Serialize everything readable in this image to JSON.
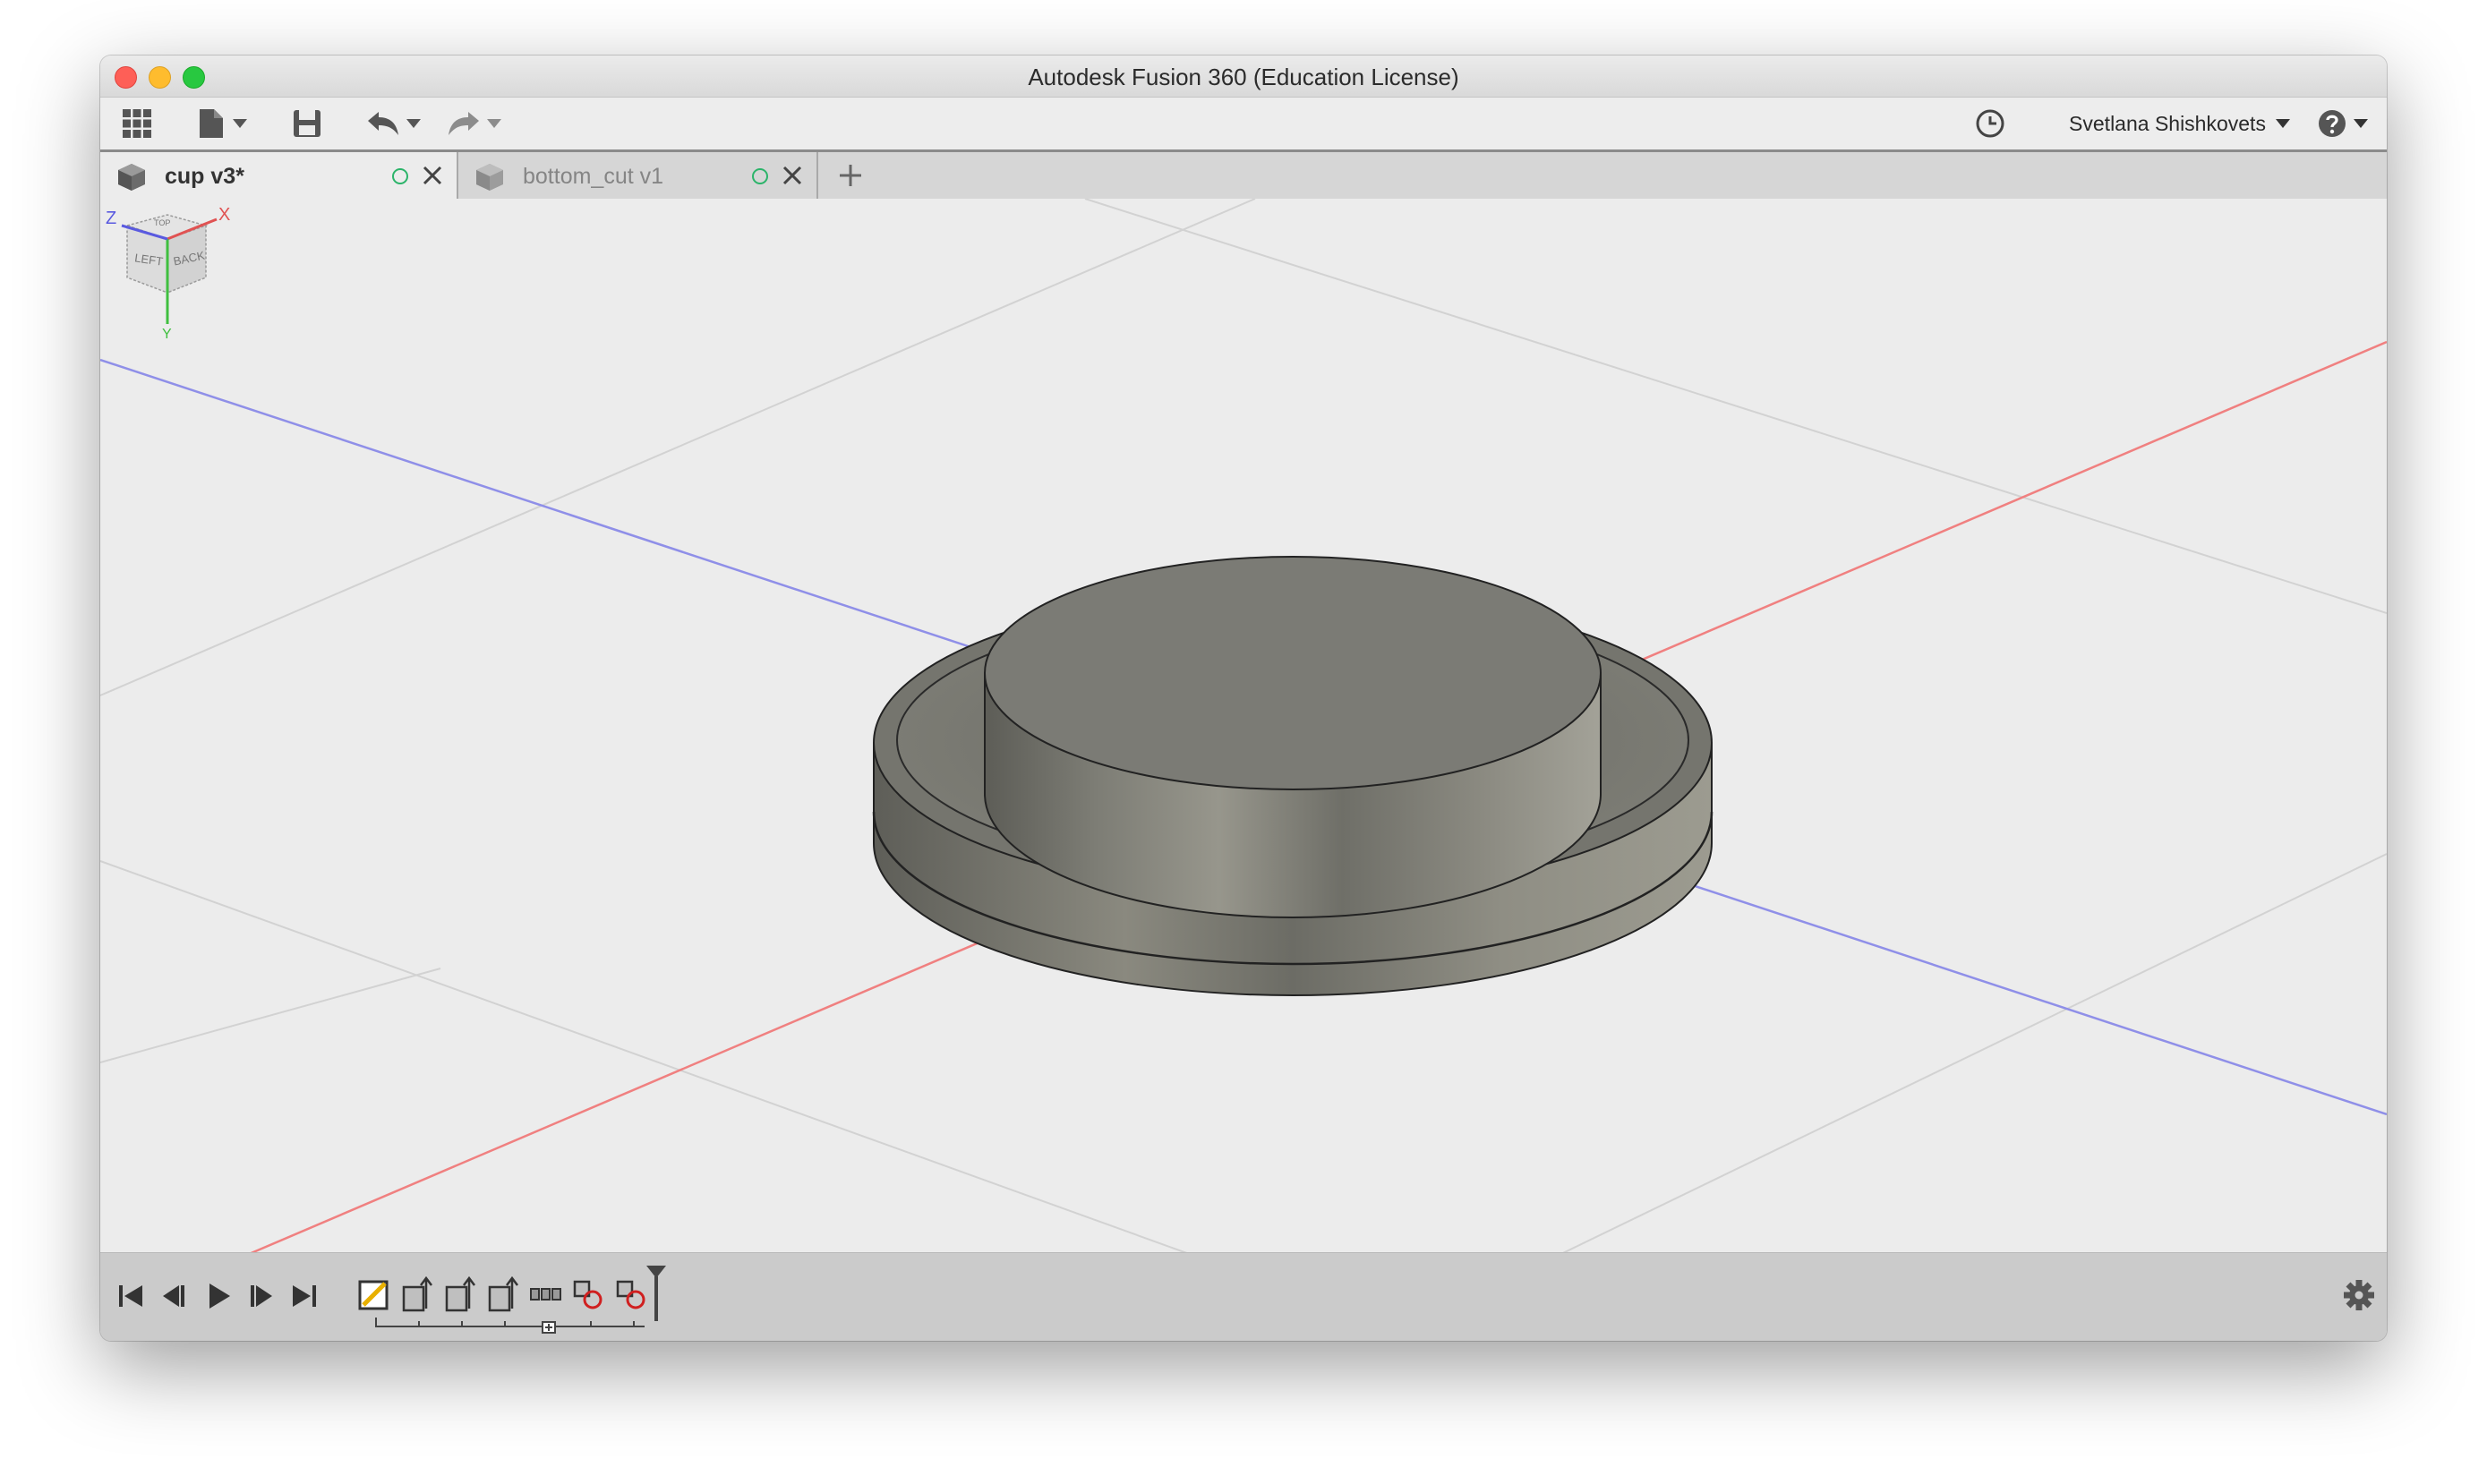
{
  "window": {
    "title": "Autodesk Fusion 360 (Education License)"
  },
  "toolbar": {
    "icons": [
      "data-panel-grid-icon",
      "file-icon",
      "save-icon",
      "undo-icon",
      "redo-icon",
      "job-status-clock-icon",
      "help-icon"
    ],
    "user_name": "Svetlana Shishkovets"
  },
  "tabs": [
    {
      "label": "cup v3*",
      "active": true,
      "status_color": "#2cb46a"
    },
    {
      "label": "bottom_cut v1",
      "active": false,
      "status_color": "#2cb46a"
    }
  ],
  "viewcube": {
    "faces": [
      "LEFT",
      "BACK",
      "TOP"
    ],
    "axes": {
      "x": "X",
      "y": "Y",
      "z": "Z"
    },
    "axis_colors": {
      "x": "#e05252",
      "y": "#3fbf3f",
      "z": "#5a5ae0"
    }
  },
  "viewport": {
    "background": "#ececec",
    "grid_color": "#d2d2d2",
    "model_color": "#7a7a72"
  },
  "timeline": {
    "controls": [
      "go-to-start-icon",
      "step-back-icon",
      "play-icon",
      "step-forward-icon",
      "go-to-end-icon"
    ],
    "features": [
      "sketch-feature-icon",
      "extrude-feature-icon",
      "extrude-feature-icon",
      "extrude-feature-icon",
      "pattern-feature-icon",
      "combine-feature-icon",
      "combine-feature-icon"
    ]
  }
}
